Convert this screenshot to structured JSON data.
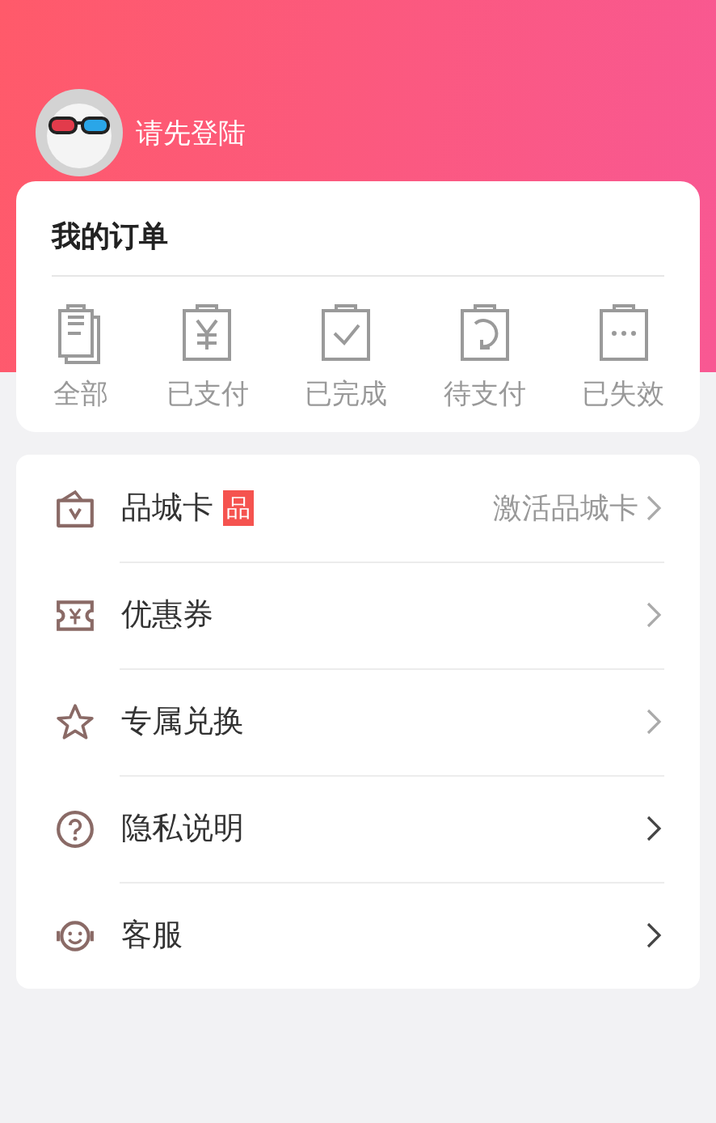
{
  "user": {
    "login_prompt": "请先登陆"
  },
  "orders": {
    "title": "我的订单",
    "items": [
      {
        "kind": "all",
        "label": "全部"
      },
      {
        "kind": "paid",
        "label": "已支付"
      },
      {
        "kind": "done",
        "label": "已完成"
      },
      {
        "kind": "pending",
        "label": "待支付"
      },
      {
        "kind": "expired",
        "label": "已失效"
      }
    ]
  },
  "menu": [
    {
      "kind": "card",
      "label": "品城卡",
      "badge": "品",
      "value": "激活品城卡"
    },
    {
      "kind": "coupon",
      "label": "优惠券"
    },
    {
      "kind": "star",
      "label": "专属兑换"
    },
    {
      "kind": "help",
      "label": "隐私说明"
    },
    {
      "kind": "service",
      "label": "客服"
    }
  ]
}
